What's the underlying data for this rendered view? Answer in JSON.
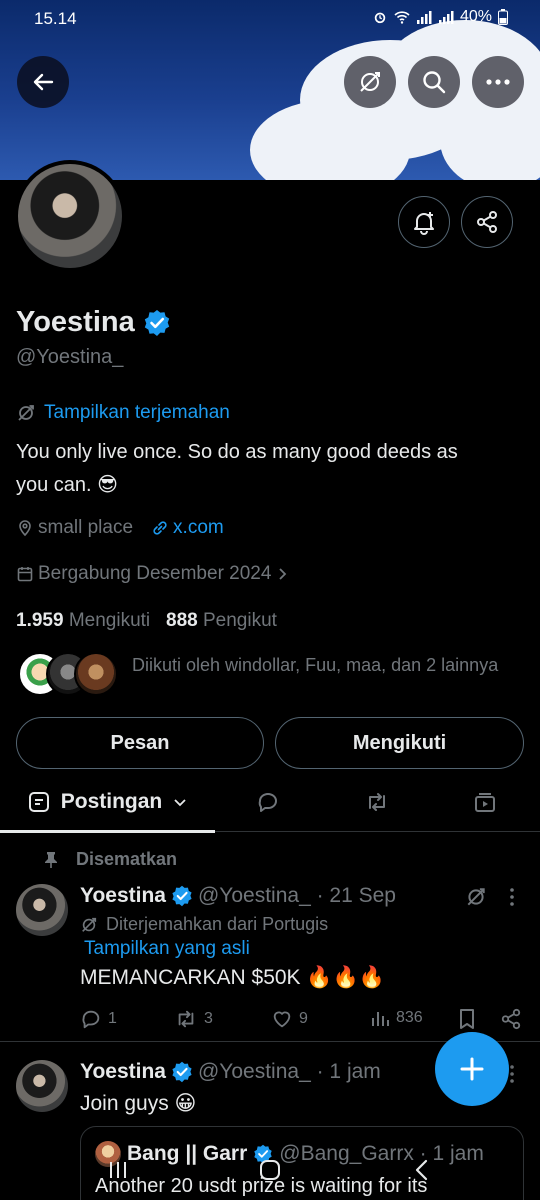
{
  "status_bar": {
    "time": "15.14",
    "battery": "40%"
  },
  "profile": {
    "name": "Yoestina",
    "handle": "@Yoestina_",
    "translate_link": "Tampilkan terjemahan",
    "bio_line1": "You only live once. So do as many good deeds as",
    "bio_line2": "you can. 😎",
    "location": "small place",
    "website": "x.com",
    "joined": "Bergabung Desember 2024",
    "following_count": "1.959",
    "following_label": "Mengikuti",
    "followers_count": "888",
    "followers_label": "Pengikut",
    "followed_by": "Diikuti oleh windollar, Fuu, maa, dan 2 lainnya"
  },
  "buttons": {
    "message": "Pesan",
    "following": "Mengikuti"
  },
  "tabs": {
    "posts": "Postingan"
  },
  "pinned_label": "Disematkan",
  "posts": [
    {
      "name": "Yoestina",
      "handle_time": "@Yoestina_ · 21 Sep",
      "translated_from": "Diterjemahkan dari Portugis",
      "show_original": "Tampilkan yang asli",
      "text": "MEMANCARKAN $50K 🔥🔥🔥",
      "replies": "1",
      "reposts": "3",
      "likes": "9",
      "views": "836"
    },
    {
      "name": "Yoestina",
      "handle_time": "@Yoestina_ · 1 jam",
      "text": "Join guys 😀",
      "quote": {
        "name": "Bang || Garr",
        "handle_time": "@Bang_Garrx · 1 jam",
        "text": "Another 20 usdt prize is waiting for its"
      }
    }
  ],
  "colors": {
    "accent": "#1d9bf0",
    "background": "#000000",
    "muted": "#71767b",
    "text": "#e7e9ea"
  }
}
